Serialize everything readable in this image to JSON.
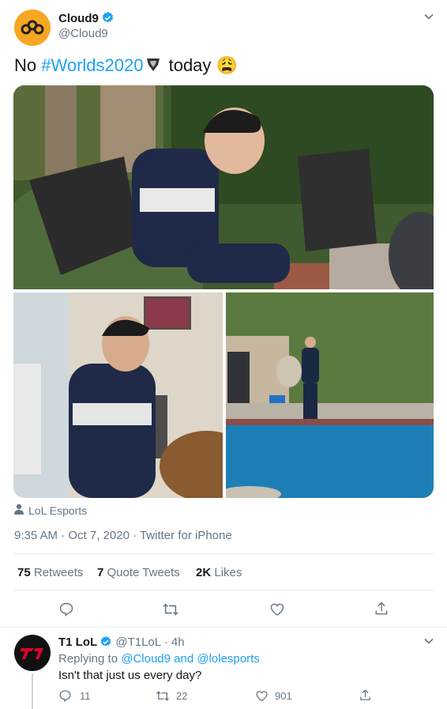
{
  "tweet": {
    "author_name": "Cloud9",
    "author_handle": "@Cloud9",
    "text_prefix": "No ",
    "hashtag": "#Worlds2020",
    "text_suffix": " today",
    "emoji": "😩",
    "tagged_user": "LoL Esports",
    "timestamp": "9:35 AM · Oct 7, 2020 · Twitter for iPhone",
    "stats": {
      "retweets_count": "75",
      "retweets_label": "Retweets",
      "quotes_count": "7",
      "quotes_label": "Quote Tweets",
      "likes_count": "2K",
      "likes_label": "Likes"
    },
    "icons": {
      "reply": "reply-icon",
      "retweet": "retweet-icon",
      "like": "like-icon",
      "share": "share-icon"
    }
  },
  "reply": {
    "author_name": "T1 LoL",
    "author_handle": "@T1LoL",
    "time": "· 4h",
    "replying_prefix": "Replying to",
    "replying_to": "@Cloud9 and @lolesports",
    "text": "Isn't that just us every day?",
    "reply_count": "11",
    "retweet_count": "22",
    "like_count": "901"
  },
  "colors": {
    "brand_blue": "#1da1f2",
    "cloud9_avatar": "#f5a623",
    "t1_avatar": "#111111",
    "t1_red": "#e2012d",
    "secondary_text": "#657786"
  }
}
